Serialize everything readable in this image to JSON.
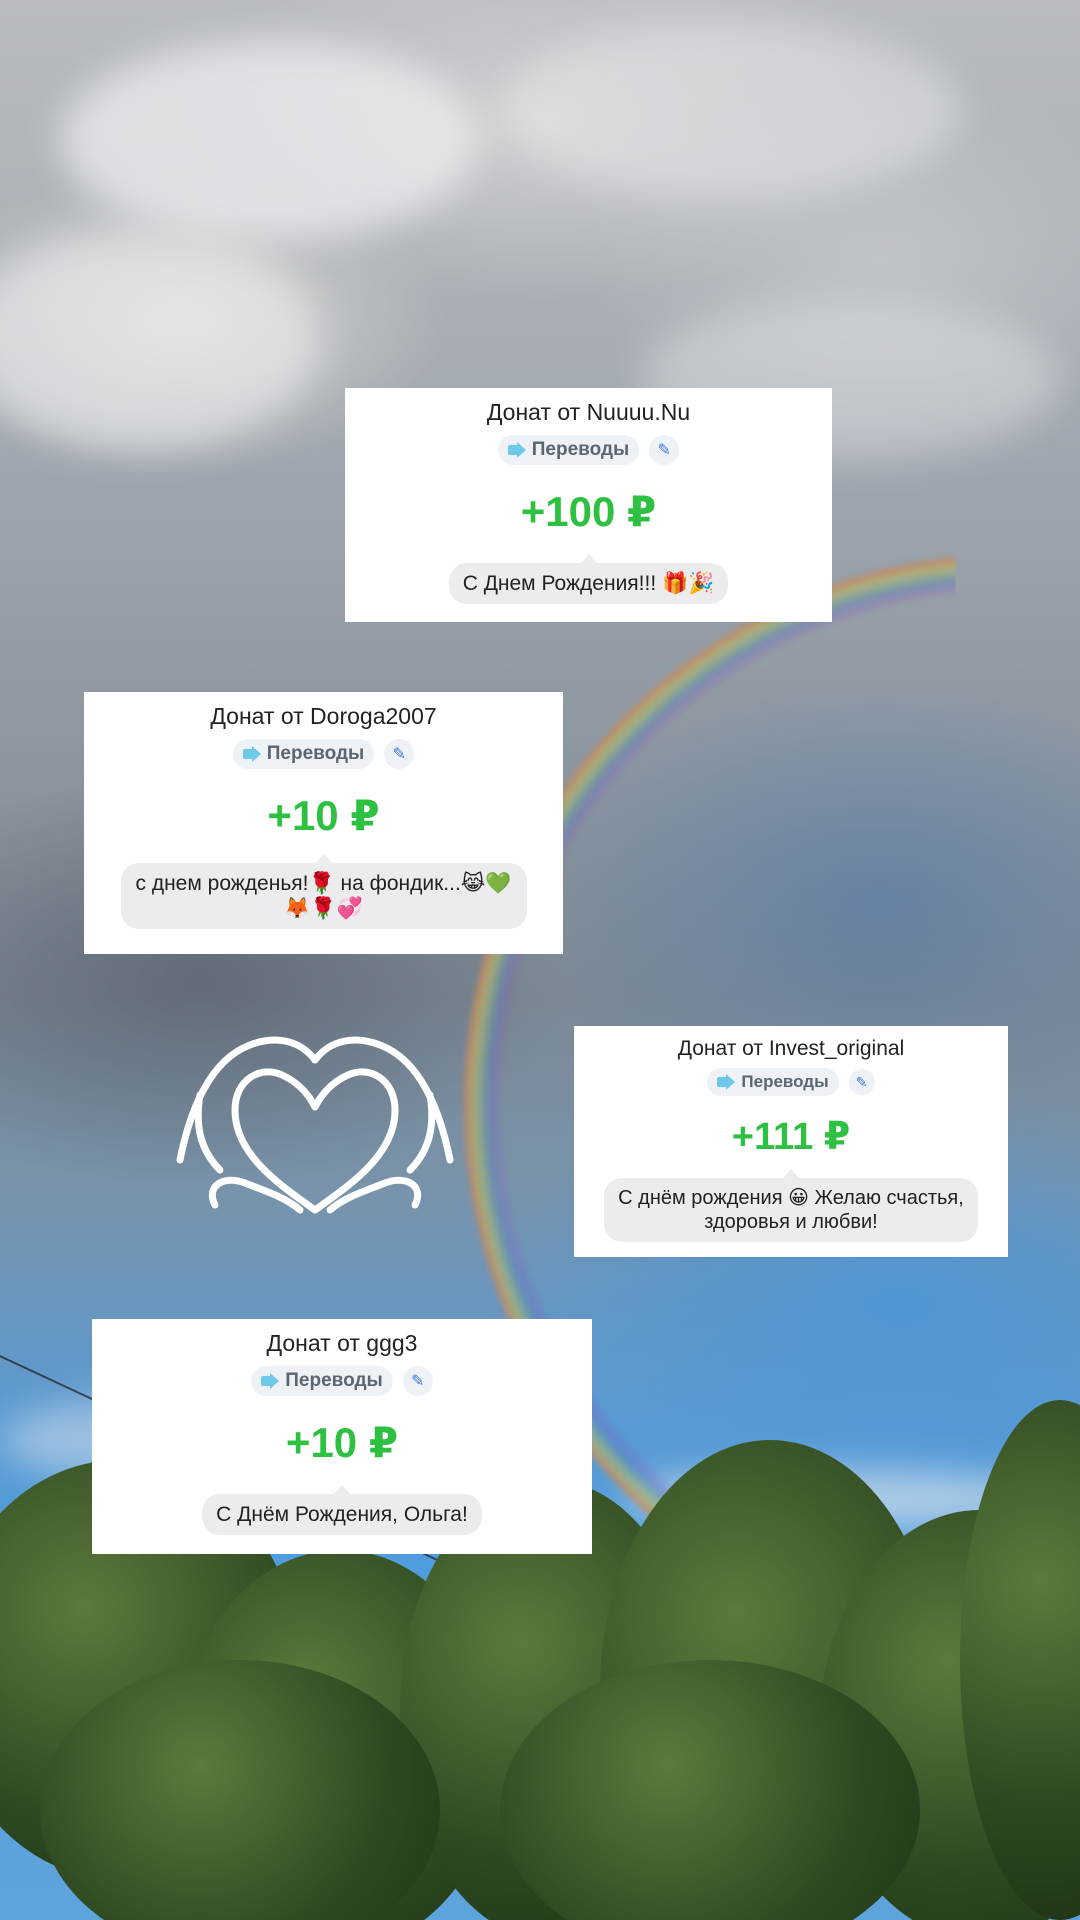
{
  "donations": [
    {
      "title": "Донат от Nuuuu.Nu",
      "category": "Переводы",
      "amount": "+100 ₽",
      "message": "С Днем Рождения!!! 🎁🎉"
    },
    {
      "title": "Донат от Doroga2007",
      "category": "Переводы",
      "amount": "+10 ₽",
      "message": "с днем рожденья!🌹 на фондик...😹💚",
      "message_line2": "🦊🌹💞"
    },
    {
      "title": "Донат от Invest_original",
      "category": "Переводы",
      "amount": "+111 ₽",
      "message": "С днём рождения 😀 Желаю счастья,",
      "message_line2": "здоровья и любви!"
    },
    {
      "title": "Донат от ggg3",
      "category": "Переводы",
      "amount": "+10 ₽",
      "message": "С Днём Рождения, Ольга!"
    }
  ],
  "icons": {
    "category": "transfer-arrow-icon",
    "edit": "pencil-icon",
    "sticker": "heart-hands-icon"
  },
  "colors": {
    "amount": "#2ec040",
    "card": "#ffffff",
    "bubble": "#ececee"
  }
}
